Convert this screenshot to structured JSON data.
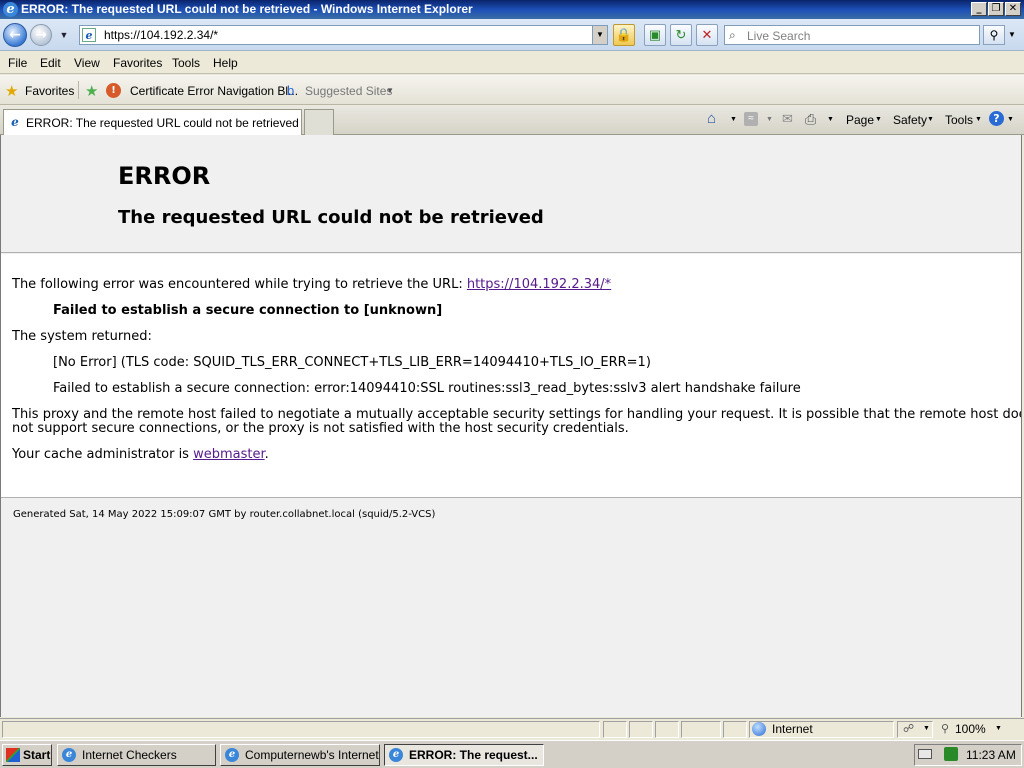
{
  "window": {
    "title": "ERROR: The requested URL could not be retrieved - Windows Internet Explorer",
    "minimize": "_",
    "maximize": "❐",
    "close": "✕"
  },
  "address": {
    "url": "https://104.192.2.34/*"
  },
  "search": {
    "placeholder": "Live Search"
  },
  "menu": [
    "File",
    "Edit",
    "View",
    "Favorites",
    "Tools",
    "Help"
  ],
  "favorites_bar": {
    "favorites_label": "Favorites",
    "items": [
      "Certificate Error Navigation Bl...",
      "Suggested Sites"
    ]
  },
  "tab": {
    "label": "ERROR: The requested URL could not be retrieved"
  },
  "command_bar": [
    "Page",
    "Safety",
    "Tools"
  ],
  "page": {
    "title": "ERROR",
    "subtitle": "The requested URL could not be retrieved",
    "intro": "The following error was encountered while trying to retrieve the URL: ",
    "intro_link": "https://104.192.2.34/*",
    "error_line": "Failed to establish a secure connection to [unknown]",
    "system_returned": "The system returned:",
    "tls_code": "[No Error] (TLS code: SQUID_TLS_ERR_CONNECT+TLS_LIB_ERR=14094410+TLS_IO_ERR=1)",
    "ssl_error": "Failed to establish a secure connection: error:14094410:SSL routines:ssl3_read_bytes:sslv3 alert handshake failure",
    "explanation_1": "This proxy and the remote host failed to negotiate a mutually acceptable security settings for handling your request. It is possible that the remote host does",
    "explanation_2": "not support secure connections, or the proxy is not satisfied with the host security credentials.",
    "admin_prefix": "Your cache administrator is ",
    "admin_link": "webmaster",
    "admin_suffix": ".",
    "footer": "Generated Sat, 14 May 2022 15:09:07 GMT by router.collabnet.local (squid/5.2-VCS)"
  },
  "status": {
    "zone": "Internet",
    "zoom": "100%"
  },
  "taskbar": {
    "start": "Start",
    "tasks": [
      "Internet Checkers",
      "Computernewb's Internet ...",
      "ERROR: The request..."
    ],
    "clock": "11:23 AM"
  }
}
